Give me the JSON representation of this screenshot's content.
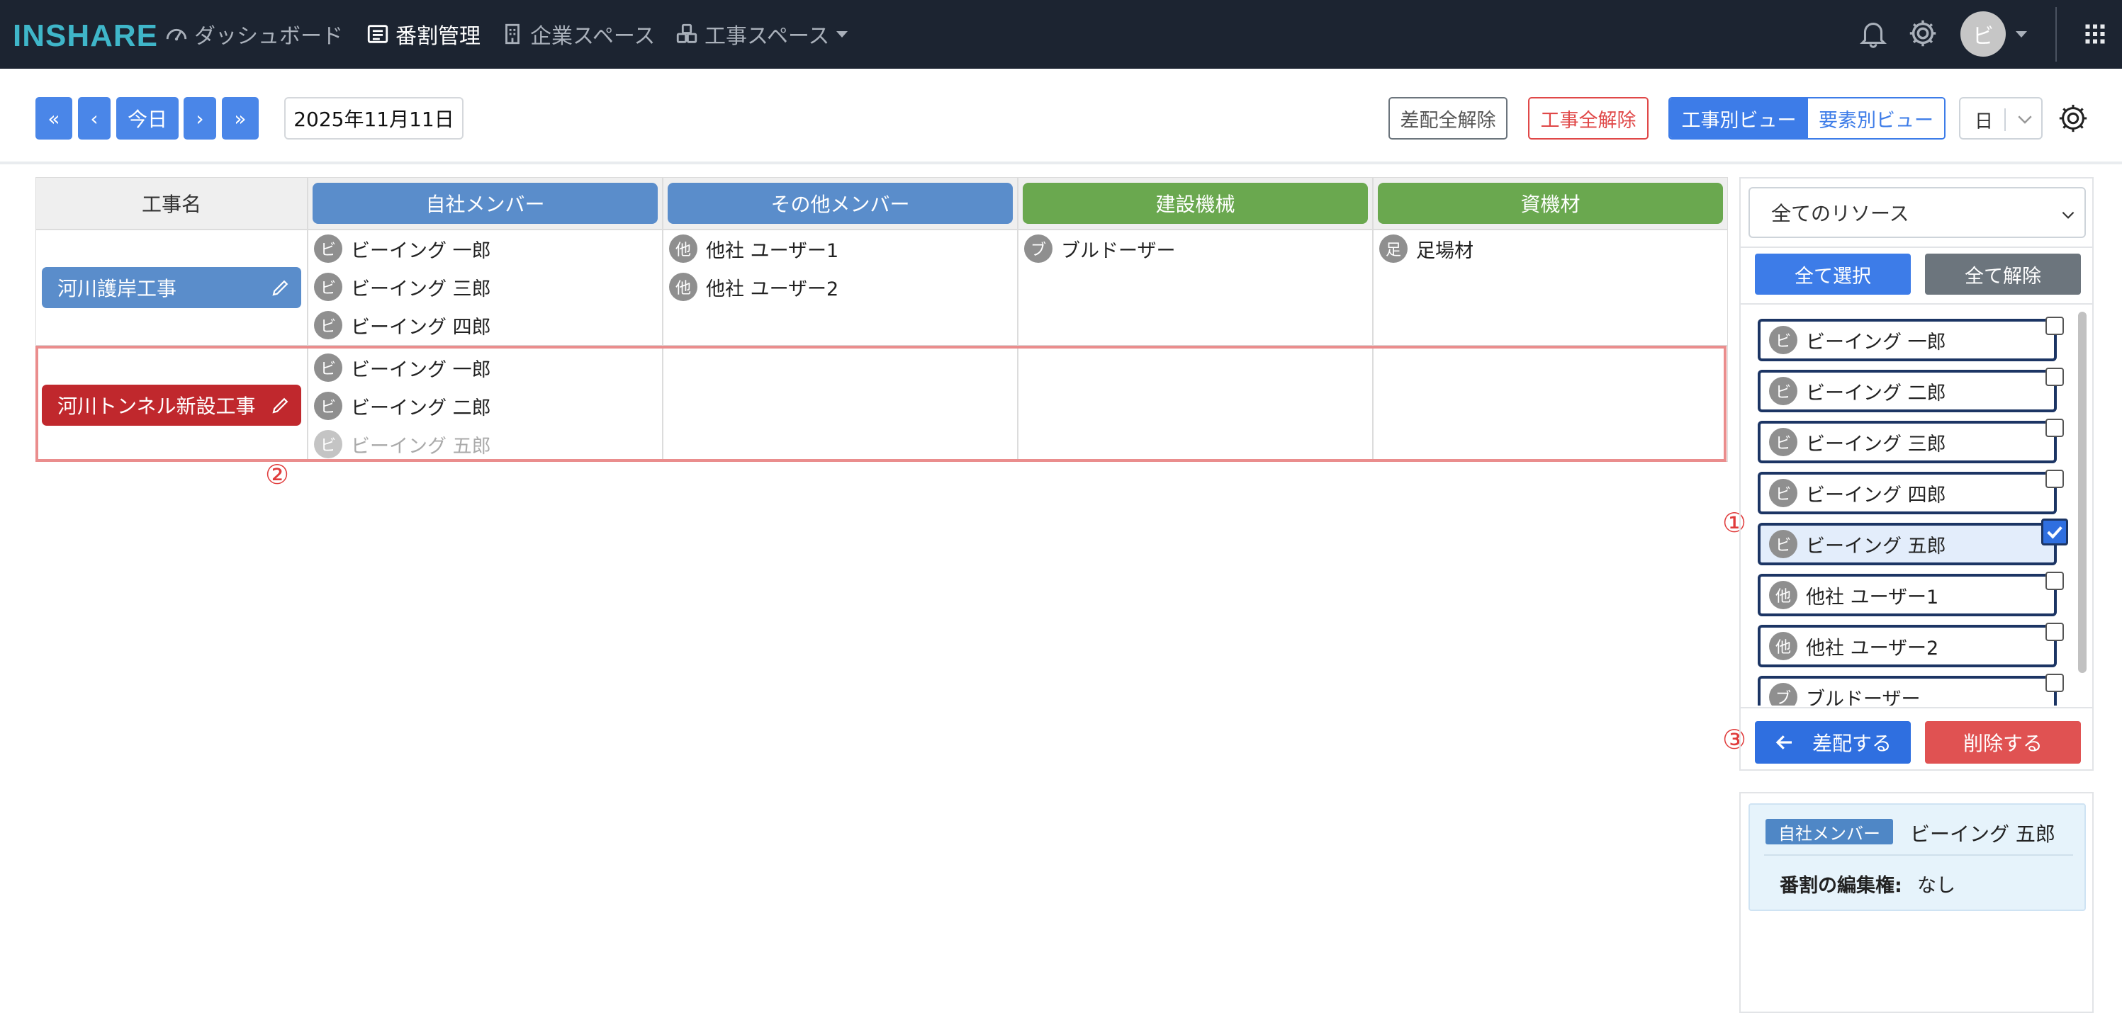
{
  "app": {
    "logo": "INSHARE",
    "nav": [
      {
        "label": "ダッシュボード",
        "icon": "dashboard-icon"
      },
      {
        "label": "番割管理",
        "icon": "list-icon"
      },
      {
        "label": "企業スペース",
        "icon": "building-icon"
      },
      {
        "label": "工事スペース",
        "icon": "cubes-icon"
      }
    ],
    "avatar_initial": "ビ"
  },
  "toolbar": {
    "first": "«",
    "prev": "‹",
    "today": "今日",
    "next": "›",
    "last": "»",
    "date": "2025年11月11日",
    "clear_assign": "差配全解除",
    "clear_project": "工事全解除",
    "view_project": "工事別ビュー",
    "view_element": "要素別ビュー",
    "unit": "日"
  },
  "table": {
    "name_header": "工事名",
    "columns": [
      {
        "label": "自社メンバー",
        "color": "#5a8dcb"
      },
      {
        "label": "その他メンバー",
        "color": "#5a8dcb"
      },
      {
        "label": "建設機械",
        "color": "#6aa84f"
      },
      {
        "label": "資機材",
        "color": "#6aa84f"
      }
    ],
    "rows": [
      {
        "project": "河川護岸工事",
        "color": "#5a8dcb",
        "cells": [
          [
            {
              "badge": "ビ",
              "name": "ビーイング 一郎"
            },
            {
              "badge": "ビ",
              "name": "ビーイング 三郎"
            },
            {
              "badge": "ビ",
              "name": "ビーイング 四郎"
            }
          ],
          [
            {
              "badge": "他",
              "name": "他社 ユーザー1"
            },
            {
              "badge": "他",
              "name": "他社 ユーザー2"
            }
          ],
          [
            {
              "badge": "ブ",
              "name": "ブルドーザー"
            }
          ],
          [
            {
              "badge": "足",
              "name": "足場材"
            }
          ]
        ]
      },
      {
        "project": "河川トンネル新設工事",
        "color": "#c0282d",
        "cells": [
          [
            {
              "badge": "ビ",
              "name": "ビーイング 一郎"
            },
            {
              "badge": "ビ",
              "name": "ビーイング 二郎"
            },
            {
              "badge": "ビ",
              "name": "ビーイング 五郎",
              "faded": true
            }
          ],
          [],
          [],
          []
        ]
      }
    ]
  },
  "markers": {
    "one": "①",
    "two": "②",
    "three": "③"
  },
  "panel": {
    "filter": "全てのリソース",
    "select_all": "全て選択",
    "deselect_all": "全て解除",
    "items": [
      {
        "badge": "ビ",
        "name": "ビーイング 一郎",
        "checked": false
      },
      {
        "badge": "ビ",
        "name": "ビーイング 二郎",
        "checked": false
      },
      {
        "badge": "ビ",
        "name": "ビーイング 三郎",
        "checked": false
      },
      {
        "badge": "ビ",
        "name": "ビーイング 四郎",
        "checked": false
      },
      {
        "badge": "ビ",
        "name": "ビーイング 五郎",
        "checked": true
      },
      {
        "badge": "他",
        "name": "他社 ユーザー1",
        "checked": false
      },
      {
        "badge": "他",
        "name": "他社 ユーザー2",
        "checked": false
      },
      {
        "badge": "ブ",
        "name": "ブルドーザー",
        "checked": false
      }
    ],
    "assign": "差配する",
    "delete": "削除する"
  },
  "detail": {
    "category": "自社メンバー",
    "name": "ビーイング 五郎",
    "label": "番割の編集権:",
    "value": "なし"
  },
  "colors": {
    "nav_bg": "#1c2431",
    "primary": "#4a86e8",
    "danger": "#e05252",
    "gray": "#6c757d",
    "accent": "#3fb6c9"
  }
}
